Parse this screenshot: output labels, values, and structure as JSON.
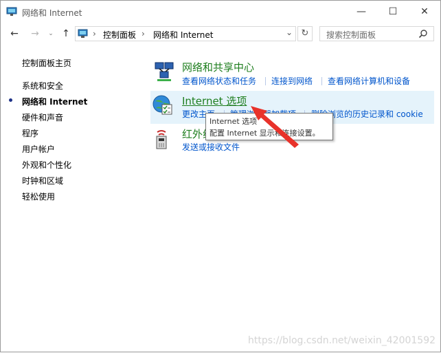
{
  "window": {
    "title": "网络和 Internet",
    "minimize": "—",
    "maximize": "☐",
    "close": "✕"
  },
  "nav": {
    "back": "←",
    "forward": "→",
    "dropdown": "⌄",
    "up": "↑",
    "refresh": "↻"
  },
  "address": {
    "crumbs": [
      "控制面板",
      "网络和 Internet"
    ],
    "dropdown": "⌄",
    "separator": "›"
  },
  "search": {
    "placeholder": "搜索控制面板"
  },
  "sidebar": {
    "items": [
      {
        "label": "控制面板主页"
      },
      {
        "label": "系统和安全"
      },
      {
        "label": "网络和 Internet",
        "selected": true
      },
      {
        "label": "硬件和声音"
      },
      {
        "label": "程序"
      },
      {
        "label": "用户帐户"
      },
      {
        "label": "外观和个性化"
      },
      {
        "label": "时钟和区域"
      },
      {
        "label": "轻松使用"
      }
    ]
  },
  "categories": [
    {
      "title": "网络和共享中心",
      "links": [
        "查看网络状态和任务",
        "连接到网络",
        "查看网络计算机和设备"
      ]
    },
    {
      "title": "Internet 选项",
      "links": [
        "更改主页",
        "管理浏览器加载项",
        "删除浏览的历史记录和 cookie"
      ]
    },
    {
      "title": "红外线",
      "links": [
        "发送或接收文件"
      ]
    }
  ],
  "tooltip": {
    "title": "Internet 选项",
    "description": "配置 Internet 显示和连接设置。"
  },
  "watermark": "https://blog.csdn.net/weixin_42001592",
  "colors": {
    "category_title": "#1e7e1e",
    "link": "#0055cc",
    "highlight": "#e5f3fb",
    "arrow": "#e8322a"
  }
}
